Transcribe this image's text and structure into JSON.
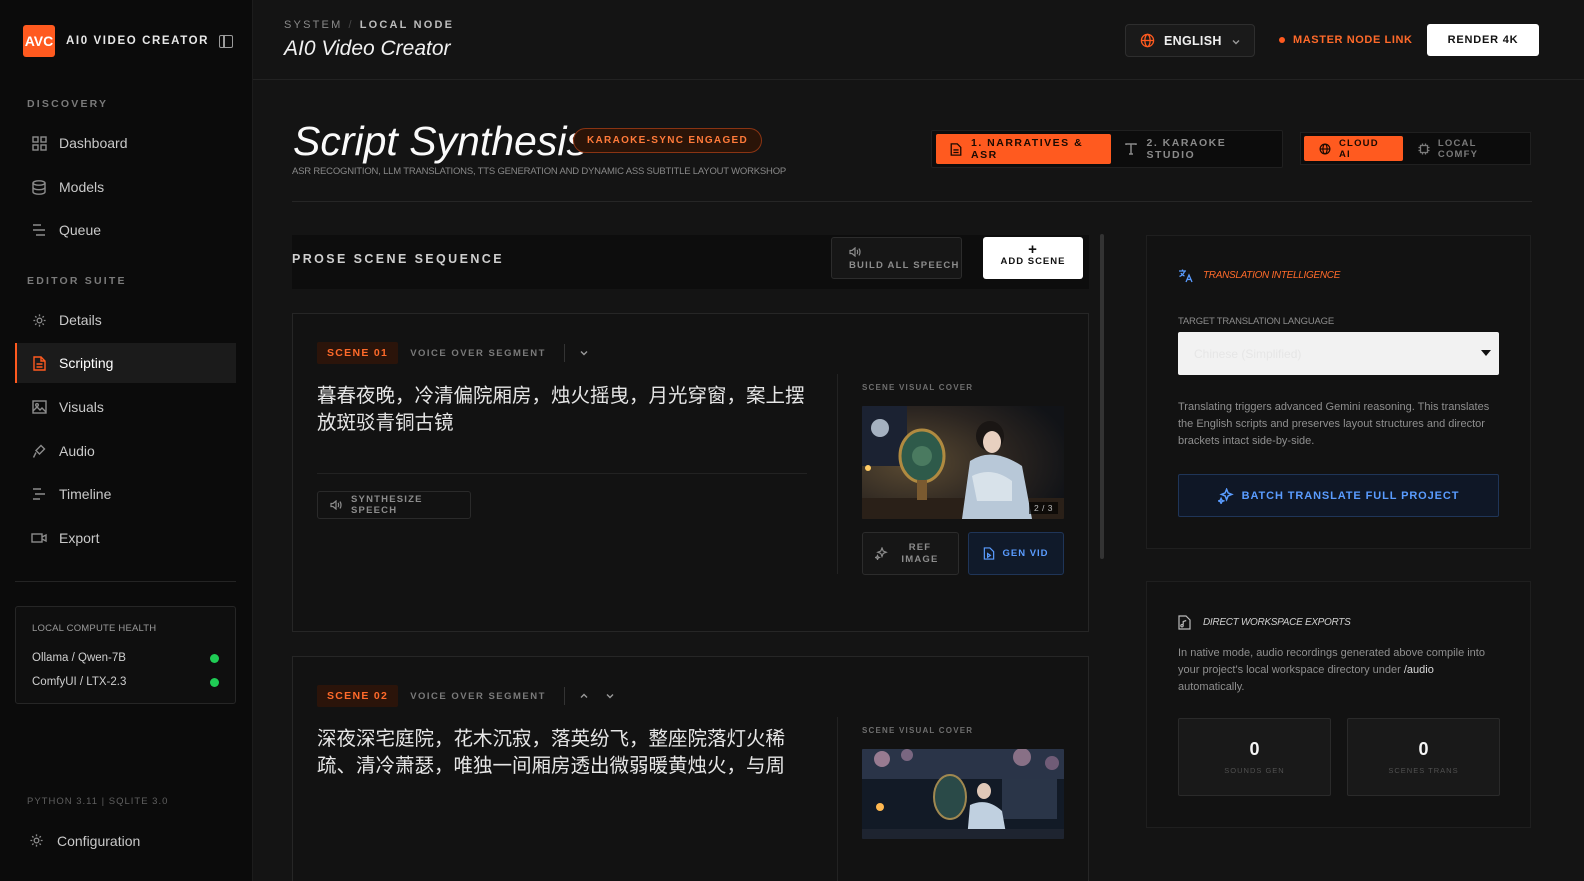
{
  "brand": {
    "logo": "AVC",
    "name": "AI0 VIDEO CREATOR"
  },
  "sidebar": {
    "sections": [
      "DISCOVERY",
      "EDITOR SUITE"
    ],
    "discovery": [
      {
        "label": "Dashboard",
        "icon": "grid-icon"
      },
      {
        "label": "Models",
        "icon": "database-icon"
      },
      {
        "label": "Queue",
        "icon": "list-icon"
      }
    ],
    "editor": [
      {
        "label": "Details",
        "icon": "gear-icon"
      },
      {
        "label": "Scripting",
        "icon": "document-icon",
        "active": true
      },
      {
        "label": "Visuals",
        "icon": "image-icon"
      },
      {
        "label": "Audio",
        "icon": "mic-icon"
      },
      {
        "label": "Timeline",
        "icon": "timeline-icon"
      },
      {
        "label": "Export",
        "icon": "video-icon"
      }
    ],
    "health": {
      "title": "LOCAL COMPUTE HEALTH",
      "items": [
        {
          "label": "Ollama / Qwen-7B",
          "status": "online"
        },
        {
          "label": "ComfyUI / LTX-2.3",
          "status": "online"
        }
      ]
    },
    "version": "PYTHON 3.11 | SQLITE 3.0",
    "config_label": "Configuration"
  },
  "topbar": {
    "crumb_system": "SYSTEM",
    "crumb_sep": "/",
    "crumb_node": "LOCAL NODE",
    "title": "AI0 Video Creator",
    "language": "ENGLISH",
    "master_link": "MASTER NODE LINK",
    "render_label": "RENDER 4K"
  },
  "header": {
    "title": "Script Synthesis",
    "badge": "KARAOKE-SYNC ENGAGED",
    "subtitle": "ASR RECOGNITION, LLM TRANSLATIONS, TTS GENERATION AND DYNAMIC ASS SUBTITLE LAYOUT WORKSHOP",
    "tabs": [
      "1. NARRATIVES & ASR",
      "2. KARAOKE STUDIO"
    ],
    "ai_tabs": [
      "CLOUD AI",
      "LOCAL COMFY"
    ]
  },
  "sequence": {
    "title": "PROSE SCENE SEQUENCE",
    "build_label": "BUILD ALL SPEECH",
    "add_label": "ADD SCENE"
  },
  "scenes": [
    {
      "badge": "SCENE 01",
      "voice_label": "VOICE OVER SEGMENT",
      "text": "暮春夜晚，冷清偏院厢房，烛火摇曳，月光穿窗，案上摆放斑驳青铜古镜",
      "synth_label": "SYNTHESIZE SPEECH",
      "visual_label": "SCENE VISUAL COVER",
      "image_count": "2 / 3",
      "ref_label": "REF IMAGE",
      "gen_label": "GEN VID"
    },
    {
      "badge": "SCENE 02",
      "voice_label": "VOICE OVER SEGMENT",
      "text": "深夜深宅庭院，花木沉寂，落英纷飞，整座院落灯火稀疏、清冷萧瑟，唯独一间厢房透出微弱暖黄烛火，与周",
      "visual_label": "SCENE VISUAL COVER"
    }
  ],
  "translation": {
    "title": "TRANSLATION INTELLIGENCE",
    "field_label": "TARGET TRANSLATION LANGUAGE",
    "selected": "Chinese (Simplified)",
    "description": "Translating triggers advanced Gemini reasoning. This translates the English scripts and preserves layout structures and director brackets intact side-by-side.",
    "batch_label": "BATCH TRANSLATE FULL PROJECT"
  },
  "exports": {
    "title": "DIRECT WORKSPACE EXPORTS",
    "desc_a": "In native mode, audio recordings generated above compile into your project's local workspace directory under ",
    "desc_path": "/audio",
    "desc_b": " automatically.",
    "stats": [
      {
        "value": "0",
        "label": "SOUNDS GEN"
      },
      {
        "value": "0",
        "label": "SCENES TRANS"
      }
    ]
  },
  "colors": {
    "accent": "#ff5a1f",
    "link_blue": "#5a9cff",
    "ok_green": "#1fcc55"
  }
}
